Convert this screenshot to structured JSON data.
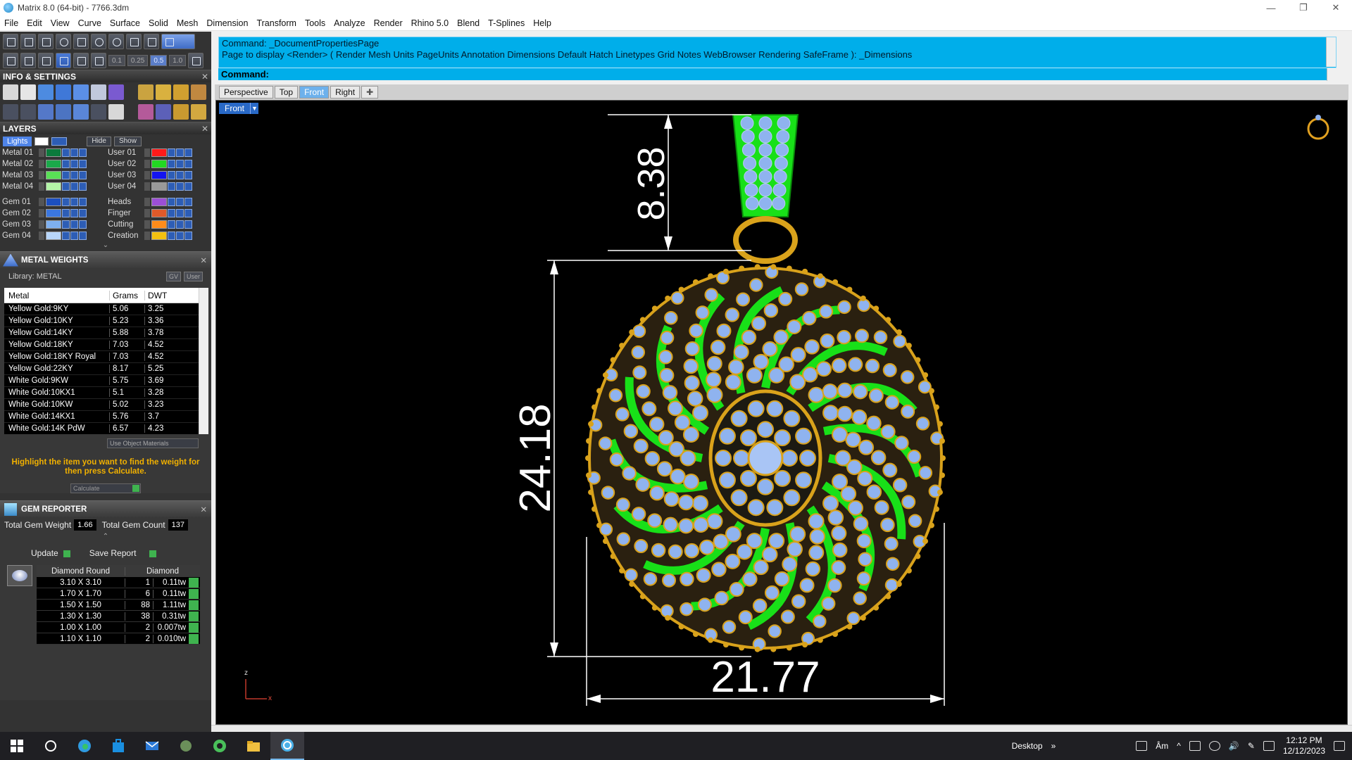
{
  "window": {
    "title": "Matrix 8.0 (64-bit) - 7766.3dm",
    "minimize": "—",
    "restore": "❐",
    "close": "✕"
  },
  "menu": [
    "File",
    "Edit",
    "View",
    "Curve",
    "Surface",
    "Solid",
    "Mesh",
    "Dimension",
    "Transform",
    "Tools",
    "Analyze",
    "Render",
    "Rhino 5.0",
    "Blend",
    "T-Splines",
    "Help"
  ],
  "toolbar": {
    "chips": [
      "0.1",
      "0.25",
      "0.5",
      "1.0"
    ]
  },
  "info_settings": {
    "title": "INFO & SETTINGS"
  },
  "layers": {
    "title": "LAYERS",
    "lights": "Lights",
    "hide": "Hide",
    "show": "Show",
    "left": [
      {
        "name": "Metal 01",
        "color": "#0b7a3c"
      },
      {
        "name": "Metal 02",
        "color": "#1aa94a"
      },
      {
        "name": "Metal 03",
        "color": "#59e056"
      },
      {
        "name": "Metal 04",
        "color": "#b4f5a8"
      },
      {
        "name": "Gem 01",
        "color": "#1c4fc0"
      },
      {
        "name": "Gem 02",
        "color": "#3b77e0"
      },
      {
        "name": "Gem 03",
        "color": "#7eb0f0"
      },
      {
        "name": "Gem 04",
        "color": "#b8d6fa"
      }
    ],
    "right": [
      {
        "name": "User 01",
        "color": "#ff1a1a"
      },
      {
        "name": "User 02",
        "color": "#22d822"
      },
      {
        "name": "User 03",
        "color": "#1414f0"
      },
      {
        "name": "User 04",
        "color": "#9a9a9a"
      },
      {
        "name": "Heads",
        "color": "#9c4fd6"
      },
      {
        "name": "Finger",
        "color": "#e05a2a"
      },
      {
        "name": "Cutting",
        "color": "#ff8c1a"
      },
      {
        "name": "Creation",
        "color": "#f2c010"
      }
    ]
  },
  "metal_weights": {
    "title": "METAL WEIGHTS",
    "library": "Library: METAL",
    "btn_gv": "GV",
    "btn_user": "User",
    "columns": [
      "Metal",
      "Grams",
      "DWT"
    ],
    "rows": [
      [
        "Yellow Gold:9KY",
        "5.06",
        "3.25"
      ],
      [
        "Yellow Gold:10KY",
        "5.23",
        "3.36"
      ],
      [
        "Yellow Gold:14KY",
        "5.88",
        "3.78"
      ],
      [
        "Yellow Gold:18KY",
        "7.03",
        "4.52"
      ],
      [
        "Yellow Gold:18KY Royal",
        "7.03",
        "4.52"
      ],
      [
        "Yellow Gold:22KY",
        "8.17",
        "5.25"
      ],
      [
        "White Gold:9KW",
        "5.75",
        "3.69"
      ],
      [
        "White Gold:10KX1",
        "5.1",
        "3.28"
      ],
      [
        "White Gold:10KW",
        "5.02",
        "3.23"
      ],
      [
        "White Gold:14KX1",
        "5.76",
        "3.7"
      ],
      [
        "White Gold:14K PdW",
        "6.57",
        "4.23"
      ]
    ],
    "use_object_materials": "Use Object Materials",
    "hint": "Highlight the item you want to find the weight for then press Calculate.",
    "calculate": "Calculate"
  },
  "gem_reporter": {
    "title": "GEM REPORTER",
    "total_weight_label": "Total Gem Weight",
    "total_weight": "1.66",
    "total_count_label": "Total Gem Count",
    "total_count": "137",
    "update": "Update",
    "save_report": "Save Report",
    "col_shape": "Diamond Round",
    "col_material": "Diamond",
    "rows": [
      [
        "3.10 X 3.10",
        "1",
        "0.11tw"
      ],
      [
        "1.70 X 1.70",
        "6",
        "0.11tw"
      ],
      [
        "1.50 X 1.50",
        "88",
        "1.11tw"
      ],
      [
        "1.30 X 1.30",
        "38",
        "0.31tw"
      ],
      [
        "1.00 X 1.00",
        "2",
        "0.007tw"
      ],
      [
        "1.10 X 1.10",
        "2",
        "0.010tw"
      ]
    ]
  },
  "command": {
    "line1": "Command: _DocumentPropertiesPage",
    "line2": "Page to display <Render> ( Render  Mesh  Units  PageUnits  Annotation  Dimensions  Default  Hatch  Linetypes  Grid  Notes  WebBrowser  Rendering  SafeFrame ): _Dimensions",
    "prompt": "Command:"
  },
  "viewport_tabs": [
    "Perspective",
    "Top",
    "Front",
    "Right"
  ],
  "viewport": {
    "label": "Front",
    "dim_top": "8.38",
    "dim_left": "24.18",
    "dim_bottom": "21.77",
    "axis_z": "z",
    "axis_x": "x",
    "colors": {
      "gold": "#d9a21b",
      "gem": "#8fb3ef",
      "green": "#18e018"
    }
  },
  "taskbar": {
    "desktop": "Desktop",
    "lang": "Âm",
    "time": "12:12 PM",
    "date": "12/12/2023"
  }
}
